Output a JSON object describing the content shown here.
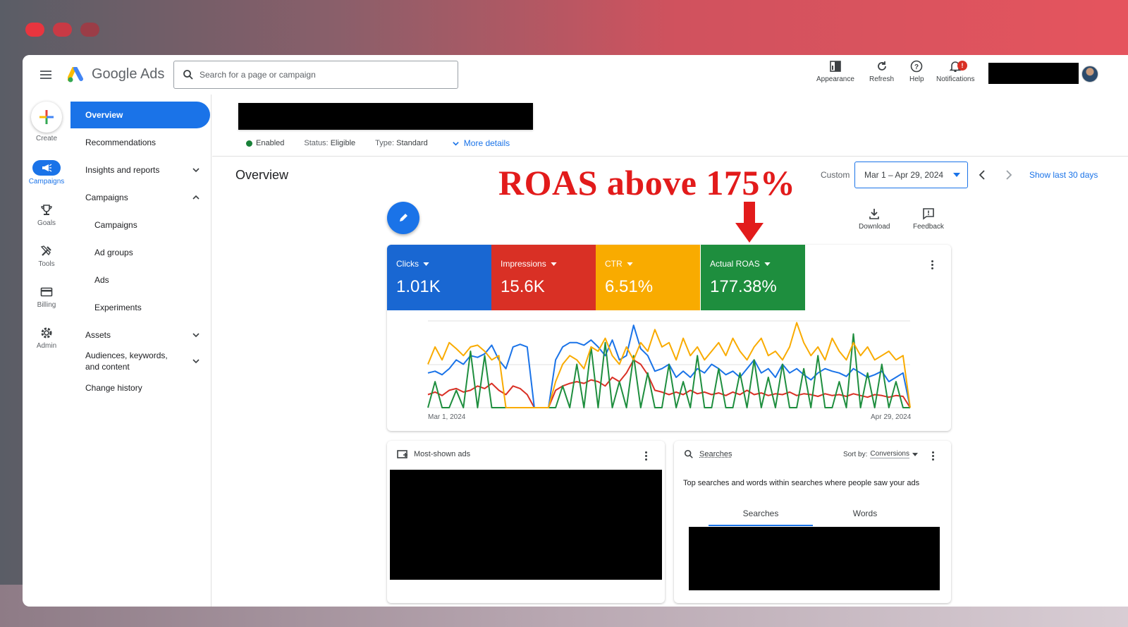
{
  "topbar": {
    "app_name": "Google Ads",
    "search_placeholder": "Search for a page or campaign",
    "buttons": [
      {
        "label": "Appearance",
        "icon": "appearance-icon"
      },
      {
        "label": "Refresh",
        "icon": "refresh-icon"
      },
      {
        "label": "Help",
        "icon": "help-icon"
      },
      {
        "label": "Notifications",
        "icon": "bell-icon",
        "badge": "!"
      }
    ]
  },
  "rail": {
    "items": [
      {
        "label": "Create",
        "icon": "plus-icon"
      },
      {
        "label": "Campaigns",
        "icon": "megaphone-icon",
        "active": true
      },
      {
        "label": "Goals",
        "icon": "trophy-icon"
      },
      {
        "label": "Tools",
        "icon": "tools-icon"
      },
      {
        "label": "Billing",
        "icon": "card-icon"
      },
      {
        "label": "Admin",
        "icon": "gear-icon"
      }
    ]
  },
  "nav": {
    "items": [
      {
        "label": "Overview",
        "active": true
      },
      {
        "label": "Recommendations"
      },
      {
        "label": "Insights and reports",
        "chevron": "down"
      },
      {
        "label": "Campaigns",
        "chevron": "up"
      },
      {
        "label": "Campaigns",
        "sub": true
      },
      {
        "label": "Ad groups",
        "sub": true
      },
      {
        "label": "Ads",
        "sub": true
      },
      {
        "label": "Experiments",
        "sub": true
      },
      {
        "label": "Assets",
        "chevron": "down"
      },
      {
        "label": "Audiences, keywords, and content",
        "chevron": "down"
      },
      {
        "label": "Change history"
      }
    ]
  },
  "campaign": {
    "enabled": "Enabled",
    "status_label": "Status:",
    "status_value": "Eligible",
    "type_label": "Type:",
    "type_value": "Standard",
    "more_details": "More details"
  },
  "overview": {
    "title": "Overview",
    "annotation": "ROAS above 175%",
    "custom_label": "Custom",
    "date_range": "Mar 1 – Apr 29, 2024",
    "show_last": "Show last 30 days",
    "download_label": "Download",
    "feedback_label": "Feedback"
  },
  "metrics": [
    {
      "name": "Clicks",
      "value": "1.01K",
      "color": "#1967d2"
    },
    {
      "name": "Impressions",
      "value": "15.6K",
      "color": "#d93025"
    },
    {
      "name": "CTR",
      "value": "6.51%",
      "color": "#f9ab00"
    },
    {
      "name": "Actual ROAS",
      "value": "177.38%",
      "color": "#1e8e3e"
    }
  ],
  "chart": {
    "x_start": "Mar 1, 2024",
    "x_end": "Apr 29, 2024"
  },
  "chart_data": {
    "type": "line",
    "x_start": "Mar 1, 2024",
    "x_end": "Apr 29, 2024",
    "grid": true,
    "series": [
      {
        "name": "Clicks",
        "color": "#1a73e8",
        "values": [
          0.4,
          0.42,
          0.38,
          0.45,
          0.55,
          0.5,
          0.6,
          0.58,
          0.62,
          0.72,
          0.55,
          0.45,
          0.7,
          0.73,
          0.7,
          0.0,
          0.0,
          0.0,
          0.55,
          0.7,
          0.75,
          0.75,
          0.72,
          0.78,
          0.7,
          0.6,
          0.78,
          0.55,
          0.6,
          0.95,
          0.68,
          0.6,
          0.42,
          0.45,
          0.5,
          0.35,
          0.42,
          0.35,
          0.45,
          0.4,
          0.5,
          0.45,
          0.38,
          0.42,
          0.35,
          0.45,
          0.55,
          0.4,
          0.45,
          0.35,
          0.5,
          0.4,
          0.45,
          0.38,
          0.32,
          0.4,
          0.45,
          0.42,
          0.4,
          0.36,
          0.45,
          0.4,
          0.35,
          0.38,
          0.42,
          0.3,
          0.35,
          0.4,
          0.0
        ]
      },
      {
        "name": "Impressions",
        "color": "#d93025",
        "values": [
          0.15,
          0.18,
          0.14,
          0.2,
          0.22,
          0.18,
          0.2,
          0.25,
          0.22,
          0.28,
          0.2,
          0.15,
          0.25,
          0.22,
          0.15,
          0.0,
          0.0,
          0.0,
          0.2,
          0.25,
          0.28,
          0.3,
          0.28,
          0.32,
          0.3,
          0.25,
          0.35,
          0.3,
          0.4,
          0.55,
          0.5,
          0.38,
          0.2,
          0.18,
          0.15,
          0.18,
          0.15,
          0.2,
          0.16,
          0.18,
          0.15,
          0.17,
          0.14,
          0.18,
          0.15,
          0.2,
          0.15,
          0.17,
          0.14,
          0.16,
          0.15,
          0.18,
          0.14,
          0.16,
          0.15,
          0.13,
          0.16,
          0.14,
          0.15,
          0.13,
          0.16,
          0.14,
          0.12,
          0.15,
          0.14,
          0.12,
          0.14,
          0.13,
          0.0
        ]
      },
      {
        "name": "CTR",
        "color": "#f9ab00",
        "values": [
          0.5,
          0.7,
          0.55,
          0.75,
          0.68,
          0.6,
          0.7,
          0.72,
          0.65,
          0.55,
          0.6,
          0.0,
          0.0,
          0.0,
          0.0,
          0.0,
          0.0,
          0.0,
          0.3,
          0.5,
          0.6,
          0.55,
          0.45,
          0.7,
          0.65,
          0.8,
          0.6,
          0.5,
          0.7,
          0.55,
          0.75,
          0.65,
          0.9,
          0.7,
          0.75,
          0.55,
          0.8,
          0.6,
          0.7,
          0.55,
          0.65,
          0.75,
          0.6,
          0.8,
          0.65,
          0.55,
          0.7,
          0.8,
          0.6,
          0.65,
          0.55,
          0.7,
          0.98,
          0.75,
          0.6,
          0.7,
          0.55,
          0.8,
          0.65,
          0.55,
          0.75,
          0.6,
          0.7,
          0.55,
          0.6,
          0.65,
          0.55,
          0.6,
          0.0
        ]
      },
      {
        "name": "Actual ROAS",
        "color": "#1e8e3e",
        "values": [
          0.0,
          0.3,
          0.0,
          0.0,
          0.2,
          0.0,
          0.65,
          0.0,
          0.6,
          0.0,
          0.0,
          0.0,
          0.0,
          0.0,
          0.0,
          0.0,
          0.0,
          0.0,
          0.0,
          0.25,
          0.0,
          0.5,
          0.0,
          0.7,
          0.0,
          0.75,
          0.0,
          0.3,
          0.0,
          0.6,
          0.0,
          0.4,
          0.0,
          0.0,
          0.5,
          0.0,
          0.3,
          0.0,
          0.6,
          0.0,
          0.0,
          0.45,
          0.0,
          0.0,
          0.4,
          0.0,
          0.55,
          0.0,
          0.35,
          0.0,
          0.5,
          0.0,
          0.0,
          0.45,
          0.0,
          0.6,
          0.0,
          0.0,
          0.3,
          0.0,
          0.85,
          0.0,
          0.4,
          0.0,
          0.5,
          0.0,
          0.3,
          0.0,
          0.0
        ]
      }
    ]
  },
  "ads_card": {
    "title": "Most-shown ads"
  },
  "searches_card": {
    "title": "Searches",
    "sort_label": "Sort by:",
    "sort_value": "Conversions",
    "description": "Top searches and words within searches where people saw your ads",
    "tabs": [
      "Searches",
      "Words"
    ]
  }
}
